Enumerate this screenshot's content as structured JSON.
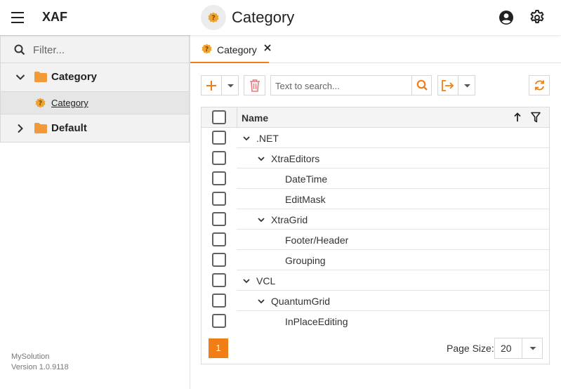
{
  "app": {
    "title": "XAF"
  },
  "header": {
    "title": "Category"
  },
  "nav": {
    "filter_placeholder": "Filter...",
    "groups": [
      {
        "label": "Category",
        "expanded": true,
        "children": [
          {
            "label": "Category",
            "selected": true
          }
        ]
      },
      {
        "label": "Default",
        "expanded": false,
        "children": []
      }
    ],
    "footer": {
      "solution": "MySolution",
      "version": "Version 1.0.9118"
    }
  },
  "tabs": [
    {
      "label": "Category",
      "active": true
    }
  ],
  "toolbar": {
    "search_placeholder": "Text to search..."
  },
  "grid": {
    "column": "Name",
    "rows": [
      {
        "label": ".NET",
        "level": 0,
        "expandable": true
      },
      {
        "label": "XtraEditors",
        "level": 1,
        "expandable": true
      },
      {
        "label": "DateTime",
        "level": 2,
        "expandable": false
      },
      {
        "label": "EditMask",
        "level": 2,
        "expandable": false
      },
      {
        "label": "XtraGrid",
        "level": 1,
        "expandable": true
      },
      {
        "label": "Footer/Header",
        "level": 2,
        "expandable": false
      },
      {
        "label": "Grouping",
        "level": 2,
        "expandable": false
      },
      {
        "label": "VCL",
        "level": 0,
        "expandable": true
      },
      {
        "label": "QuantumGrid",
        "level": 1,
        "expandable": true
      },
      {
        "label": "InPlaceEditing",
        "level": 2,
        "expandable": false
      }
    ]
  },
  "pager": {
    "current_page": "1",
    "page_size_label": "Page Size:",
    "page_size": "20"
  },
  "colors": {
    "accent": "#f07d16",
    "delete": "#e8797a"
  },
  "icons": {
    "menu": "hamburger-icon",
    "user": "account-circle-icon",
    "settings": "gear-icon",
    "view": "question-badge-icon",
    "folder": "folder-icon",
    "search": "search-icon",
    "add": "plus-icon",
    "delete": "trash-icon",
    "export": "export-icon",
    "refresh": "refresh-icon",
    "sort": "arrow-up-icon",
    "filter": "funnel-icon"
  }
}
